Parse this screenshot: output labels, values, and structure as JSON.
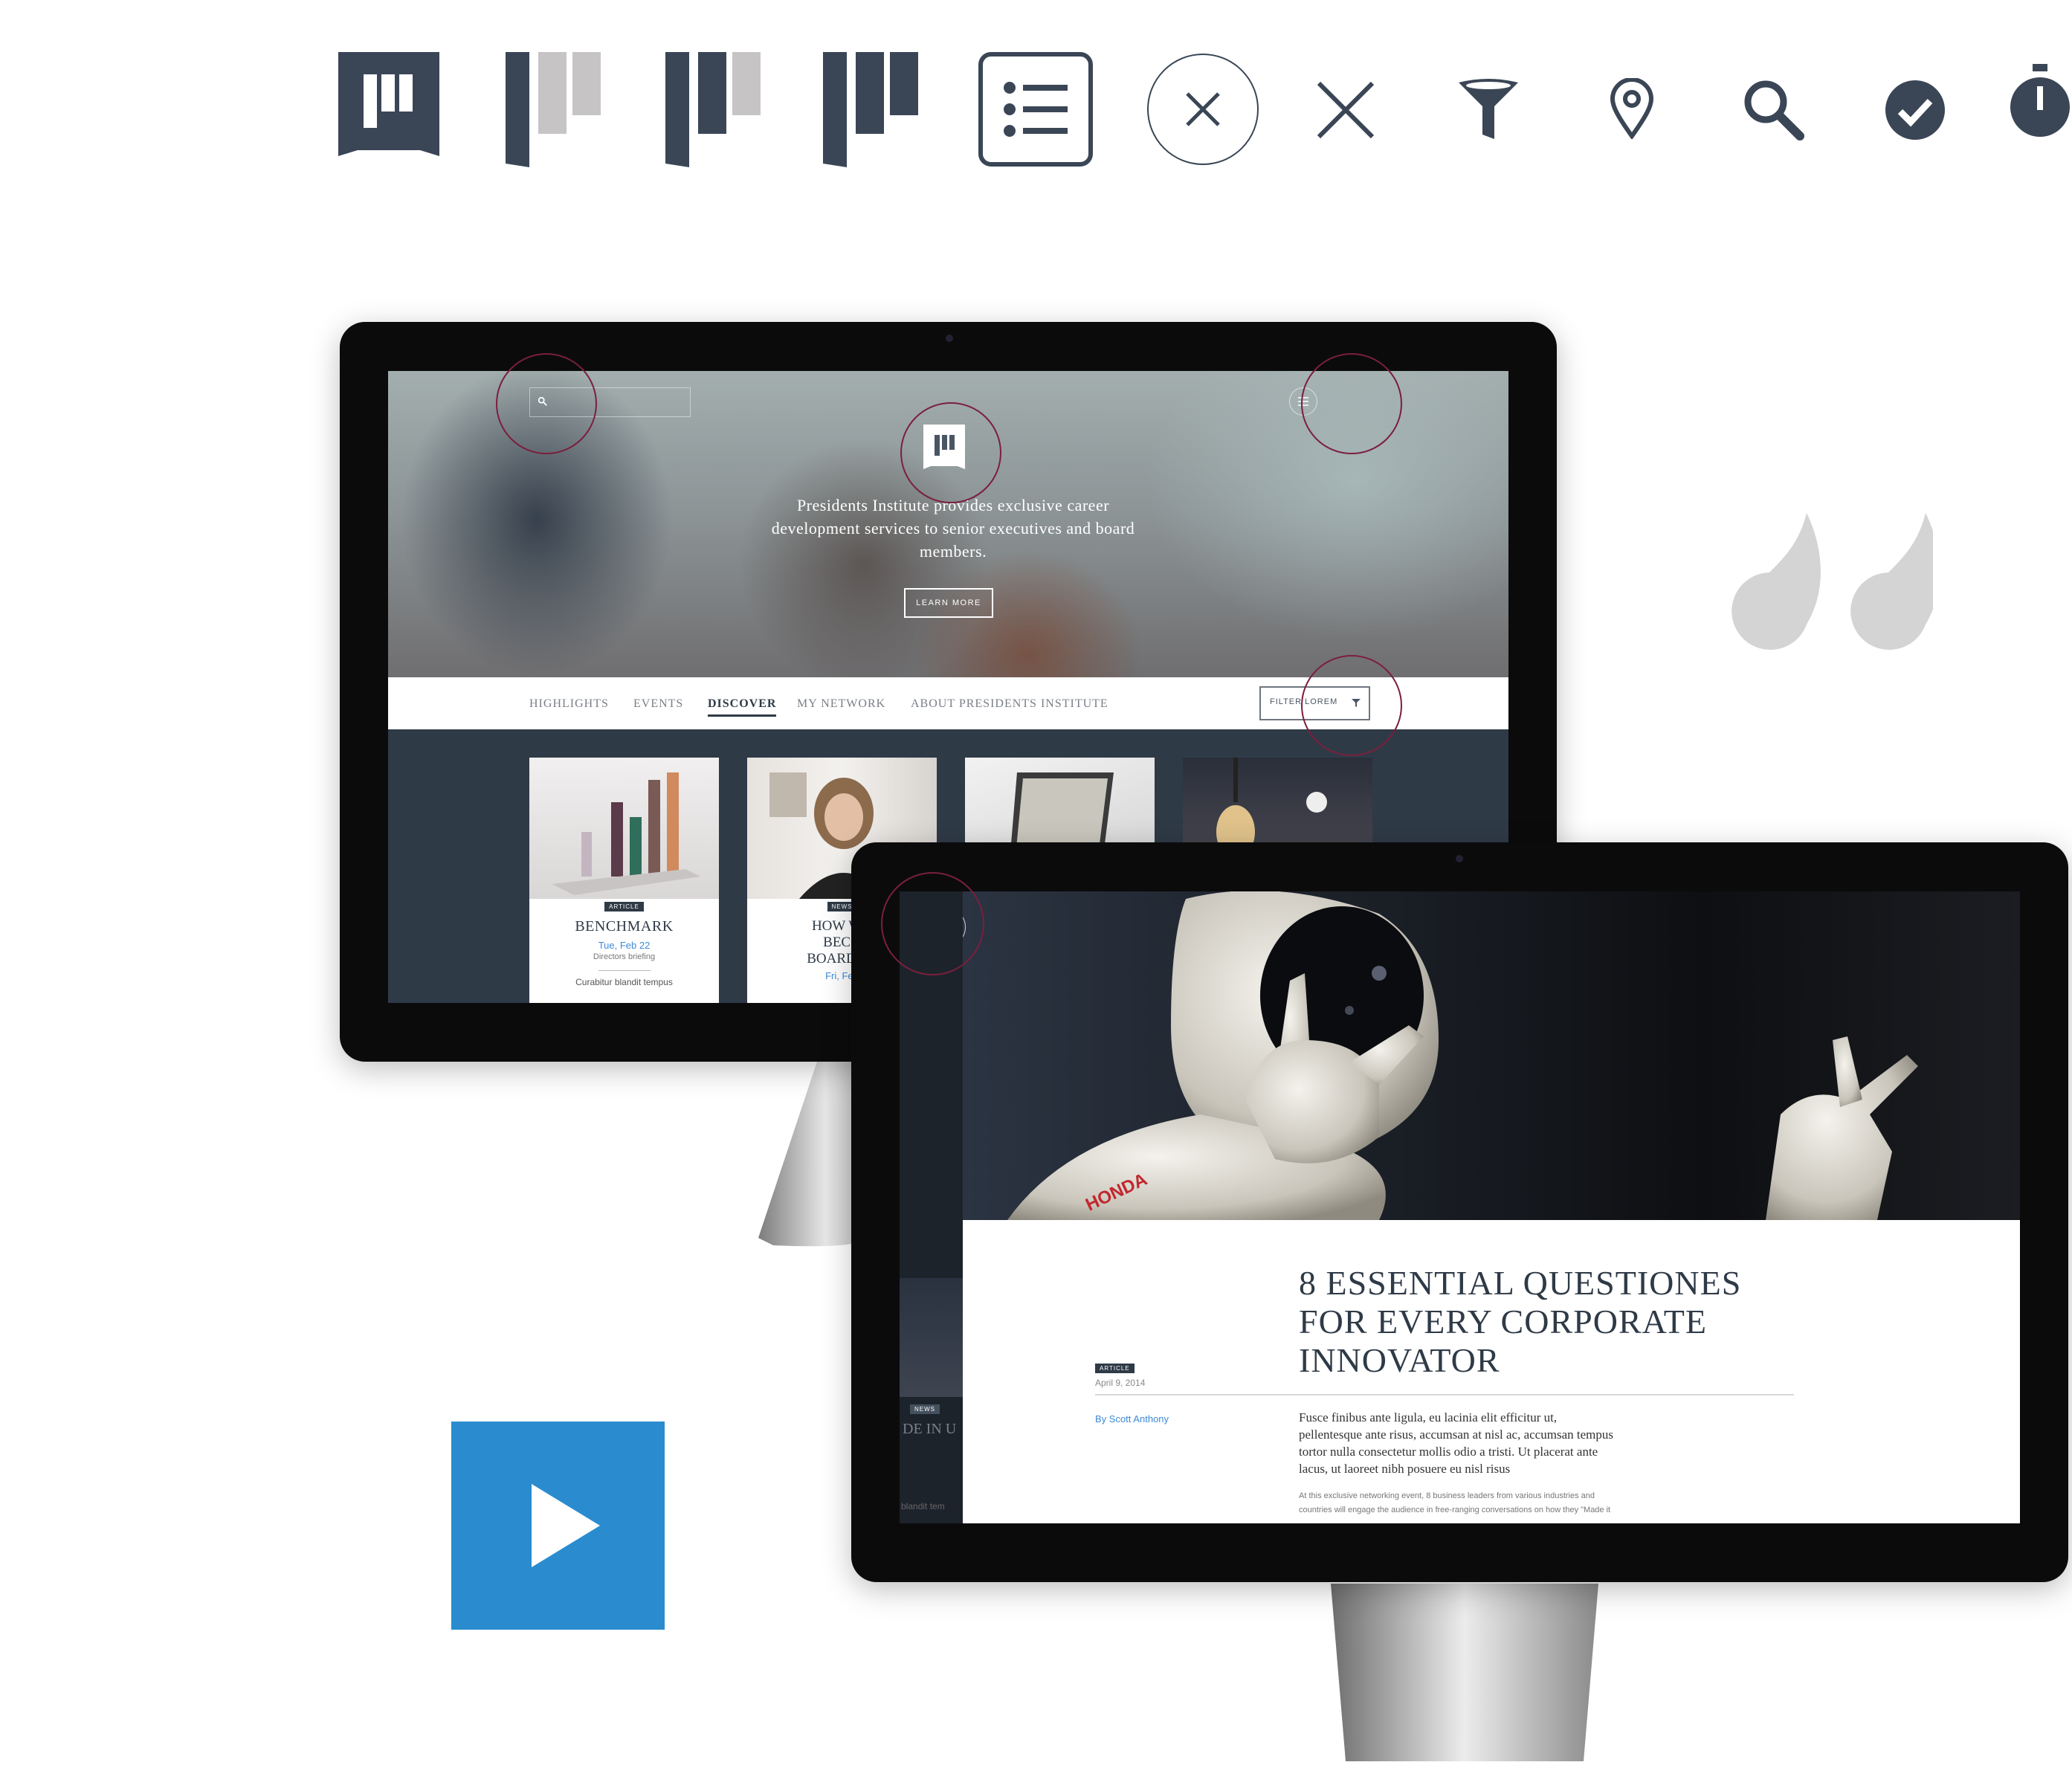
{
  "colors": {
    "navy": "#2f3a47",
    "light_gray": "#c7c4c5",
    "annotation": "#7b1f3d",
    "accent_blue": "#2a8ccf",
    "link_blue": "#3c8ad6"
  },
  "icon_row": [
    "logo-badge-icon",
    "logo-variant-light-icon",
    "logo-variant-mixed-icon",
    "logo-variant-dark-icon",
    "list-menu-icon",
    "close-circle-icon",
    "close-icon",
    "filter-icon",
    "location-pin-icon",
    "search-icon",
    "check-circle-icon",
    "stopwatch-icon"
  ],
  "monitor1": {
    "hero_text": "Presidents Institute provides exclusive career development services to senior executives and board members.",
    "learn_more": "LEARN MORE",
    "nav": {
      "highlights": "HIGHLIGHTS",
      "events": "EVENTS",
      "discover": "DISCOVER",
      "my_network": "MY NETWORK",
      "about": "ABOUT PRESIDENTS INSTITUTE"
    },
    "filter_label": "FILTER LOREM",
    "cards": [
      {
        "badge": "ARTICLE",
        "title": "BENCHMARK",
        "date": "Tue, Feb 22",
        "sub": "Directors briefing",
        "snippet": "Curabitur blandit tempus"
      },
      {
        "badge": "NEWS",
        "title_l1": "HOW WO",
        "title_l2": "BECO",
        "title_l3": "BOARD MI",
        "date": "Fri, Feb"
      }
    ]
  },
  "monitor2": {
    "badge": "ARTICLE",
    "date": "April 9, 2014",
    "title_l1": "8 ESSENTIAL QUESTIONES",
    "title_l2": "FOR EVERY CORPORATE",
    "title_l3": "INNOVATOR",
    "author": "By Scott Anthony",
    "lead_l1": "Fusce finibus ante ligula, eu lacinia elit efficitur ut,",
    "lead_l2": "pellentesque ante risus, accumsan at nisl ac, accumsan tempus",
    "lead_l3": "tortor nulla consectetur mollis odio a tristi. Ut placerat ante",
    "lead_l4": "lacus, ut laoreet nibh posuere eu nisl risus",
    "body_l1": "At this exclusive networking event, 8 business leaders from various industries and",
    "body_l2": "countries will engage the audience in free-ranging conversations on how they \"Made it",
    "behind_badge": "NEWS",
    "behind_text": "DE IN U",
    "behind_text2": "blandit tem",
    "robot_brand": "HONDA"
  }
}
